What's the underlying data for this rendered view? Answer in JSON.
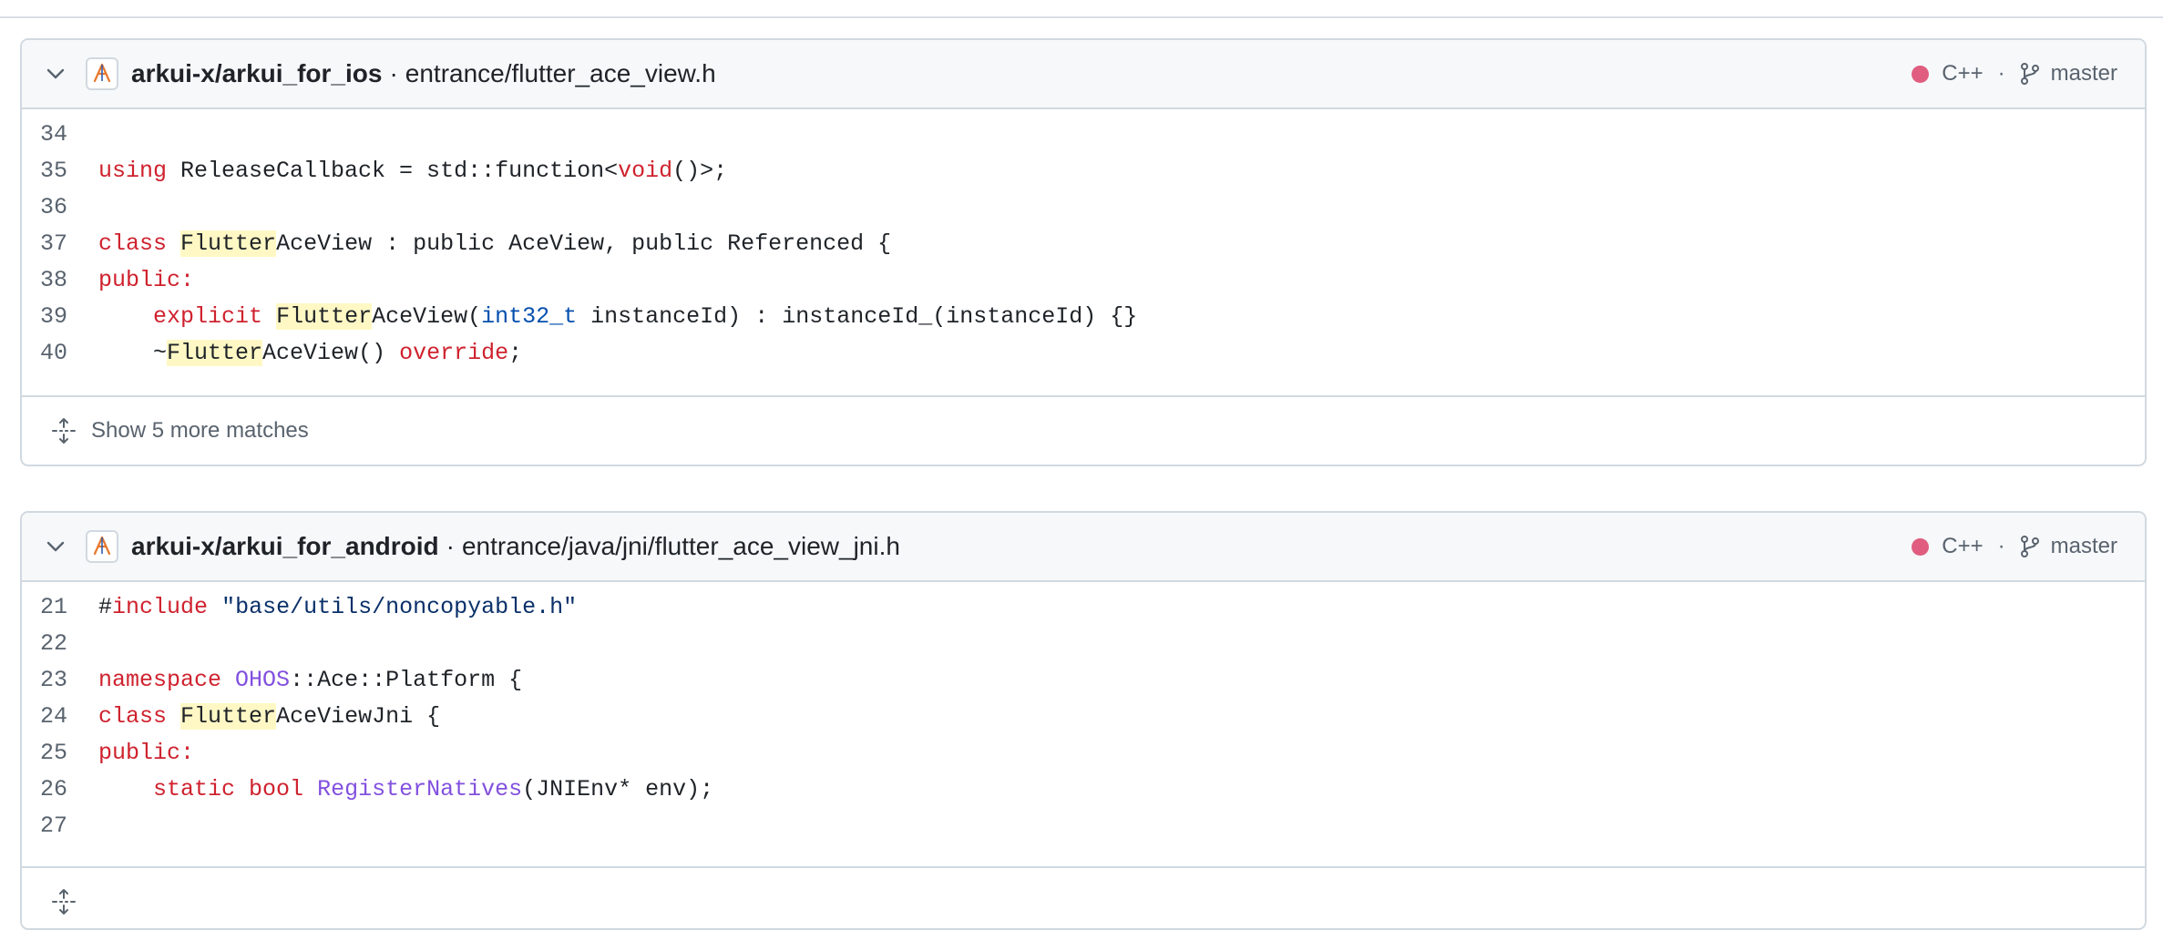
{
  "colors": {
    "cpp_dot": "#e05d7f"
  },
  "results": [
    {
      "repo": "arkui-x/arkui_for_ios",
      "separator": "·",
      "path": "entrance/flutter_ace_view.h",
      "language": "C++",
      "meta_separator": "·",
      "branch": "master",
      "show_more": "Show 5 more matches",
      "lines": [
        {
          "n": "34",
          "tokens": []
        },
        {
          "n": "35",
          "tokens": [
            {
              "t": "using",
              "c": "kw"
            },
            {
              "t": " ReleaseCallback = std::function<",
              "c": "src"
            },
            {
              "t": "void",
              "c": "kw"
            },
            {
              "t": "()>;",
              "c": "src"
            }
          ]
        },
        {
          "n": "36",
          "tokens": []
        },
        {
          "n": "37",
          "tokens": [
            {
              "t": "class",
              "c": "kw"
            },
            {
              "t": " ",
              "c": "src"
            },
            {
              "t": "Flutter",
              "c": "hl"
            },
            {
              "t": "AceView : public AceView, public Referenced {",
              "c": "src"
            }
          ]
        },
        {
          "n": "38",
          "tokens": [
            {
              "t": "public:",
              "c": "kw"
            }
          ]
        },
        {
          "n": "39",
          "tokens": [
            {
              "t": "    ",
              "c": "src"
            },
            {
              "t": "explicit",
              "c": "kw"
            },
            {
              "t": " ",
              "c": "src"
            },
            {
              "t": "Flutter",
              "c": "hl"
            },
            {
              "t": "AceView(",
              "c": "src"
            },
            {
              "t": "int32_t",
              "c": "ty"
            },
            {
              "t": " instanceId) : instanceId_(instanceId) {}",
              "c": "src"
            }
          ]
        },
        {
          "n": "40",
          "tokens": [
            {
              "t": "    ~",
              "c": "src"
            },
            {
              "t": "Flutter",
              "c": "hl"
            },
            {
              "t": "AceView() ",
              "c": "src"
            },
            {
              "t": "override",
              "c": "kw"
            },
            {
              "t": ";",
              "c": "src"
            }
          ]
        }
      ]
    },
    {
      "repo": "arkui-x/arkui_for_android",
      "separator": "·",
      "path": "entrance/java/jni/flutter_ace_view_jni.h",
      "language": "C++",
      "meta_separator": "·",
      "branch": "master",
      "show_more": "",
      "lines": [
        {
          "n": "21",
          "tokens": [
            {
              "t": "#",
              "c": "src"
            },
            {
              "t": "include",
              "c": "kw"
            },
            {
              "t": " ",
              "c": "src"
            },
            {
              "t": "\"base/utils/noncopyable.h\"",
              "c": "str"
            }
          ]
        },
        {
          "n": "22",
          "tokens": []
        },
        {
          "n": "23",
          "tokens": [
            {
              "t": "namespace",
              "c": "kw"
            },
            {
              "t": " ",
              "c": "src"
            },
            {
              "t": "OHOS",
              "c": "fn"
            },
            {
              "t": "::Ace::Platform {",
              "c": "src"
            }
          ]
        },
        {
          "n": "24",
          "tokens": [
            {
              "t": "class",
              "c": "kw"
            },
            {
              "t": " ",
              "c": "src"
            },
            {
              "t": "Flutter",
              "c": "hl"
            },
            {
              "t": "AceViewJni {",
              "c": "src"
            }
          ]
        },
        {
          "n": "25",
          "tokens": [
            {
              "t": "public:",
              "c": "kw"
            }
          ]
        },
        {
          "n": "26",
          "tokens": [
            {
              "t": "    ",
              "c": "src"
            },
            {
              "t": "static",
              "c": "kw"
            },
            {
              "t": " ",
              "c": "src"
            },
            {
              "t": "bool",
              "c": "kw"
            },
            {
              "t": " ",
              "c": "src"
            },
            {
              "t": "RegisterNatives",
              "c": "fn"
            },
            {
              "t": "(JNIEnv* env);",
              "c": "src"
            }
          ]
        },
        {
          "n": "27",
          "tokens": []
        }
      ]
    }
  ]
}
